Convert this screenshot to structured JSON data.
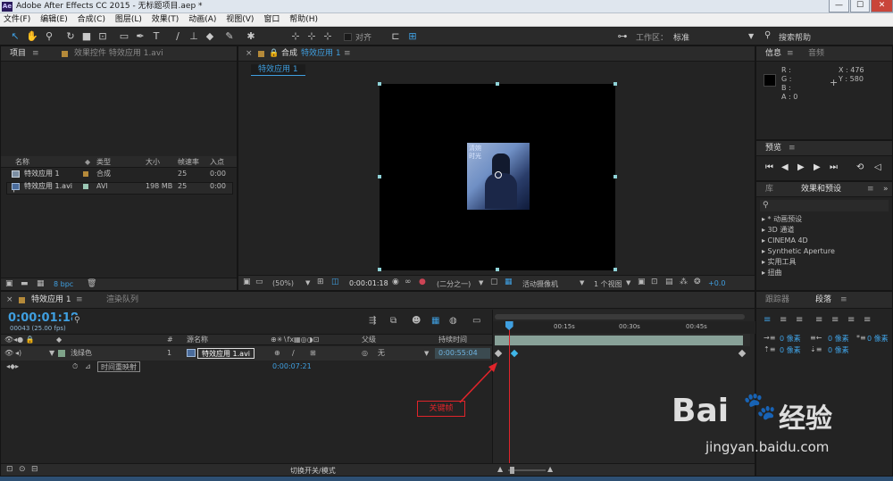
{
  "window": {
    "title": "Adobe After Effects CC 2015 - 无标题项目.aep *",
    "logo": "Ae",
    "min": "—",
    "max": "☐",
    "close": "✕"
  },
  "menu": [
    "文件(F)",
    "编辑(E)",
    "合成(C)",
    "图层(L)",
    "效果(T)",
    "动画(A)",
    "视图(V)",
    "窗口",
    "帮助(H)"
  ],
  "toolbar": {
    "align_label": "对齐",
    "workspace_label": "工作区：",
    "workspace_value": "标准",
    "search_placeholder": "搜索帮助"
  },
  "project": {
    "tab": "项目",
    "effect_controls_tab": "效果控件 特效应用 1.avi",
    "search_icon": "search-icon",
    "columns": [
      "名称",
      "类型",
      "大小",
      "帧速率",
      "入点"
    ],
    "items": [
      {
        "name": "特效应用 1",
        "type": "合成",
        "size": "",
        "fps": "25",
        "in": "0:00"
      },
      {
        "name": "特效应用 1.avi",
        "type": "AVI",
        "size": "198 MB",
        "fps": "25",
        "in": "0:00"
      }
    ],
    "bpc": "8 bpc"
  },
  "comp": {
    "tab_prefix": "合成",
    "tab_name": "特效应用 1",
    "sub_tab": "特效应用 1",
    "zoom": "(50%)",
    "timecode": "0:00:01:18",
    "resolution": "(二分之一)",
    "camera": "活动摄像机",
    "views": "1 个视图",
    "exposure": "+0.0",
    "image_text": "清婉\n时光"
  },
  "info": {
    "tab": "信息",
    "audio_tab": "音频",
    "r": "R :",
    "g": "G :",
    "b": "B :",
    "a": "A : 0",
    "x": "X : 476",
    "y": "Y : 580"
  },
  "preview": {
    "tab": "预览"
  },
  "effects": {
    "lib_tab": "库",
    "tab": "效果和预设",
    "items": [
      "▸ * 动画预设",
      "▸ 3D 通道",
      "▸ CINEMA 4D",
      "▸ Synthetic Aperture",
      "▸ 实用工具",
      "▸ 扭曲"
    ]
  },
  "timeline": {
    "tab": "特效应用 1",
    "render_tab": "渲染队列",
    "timecode": "0:00:01:18",
    "frames": "00043 (25.00 fps)",
    "cols": {
      "num": "#",
      "source": "源名称",
      "parent": "父级",
      "duration": "持续时间"
    },
    "layer": {
      "label": "浅绿色",
      "num": "1",
      "source": "特效应用 1.avi",
      "parent": "无",
      "duration": "0:00:55:04"
    },
    "property": {
      "name": "时间重映射",
      "value": "0:00:07:21"
    },
    "ruler": [
      "00:15s",
      "00:30s",
      "00:45s"
    ],
    "toggle_label": "切换开关/模式",
    "annotation": "关键帧",
    "playhead_pos": 0.02
  },
  "tracker": {
    "tab": "跟踪器",
    "para_tab": "段落",
    "px": "0 像素",
    "px2": "0 像素"
  },
  "watermark": {
    "brand": "Bai",
    "brand_cn": "经验",
    "url": "jingyan.baidu.com"
  },
  "colors": {
    "accent": "#3f9fe0",
    "label_green": "#7fa48a",
    "annotation_red": "#e0242a",
    "layer_bar": "#a8c9be"
  }
}
